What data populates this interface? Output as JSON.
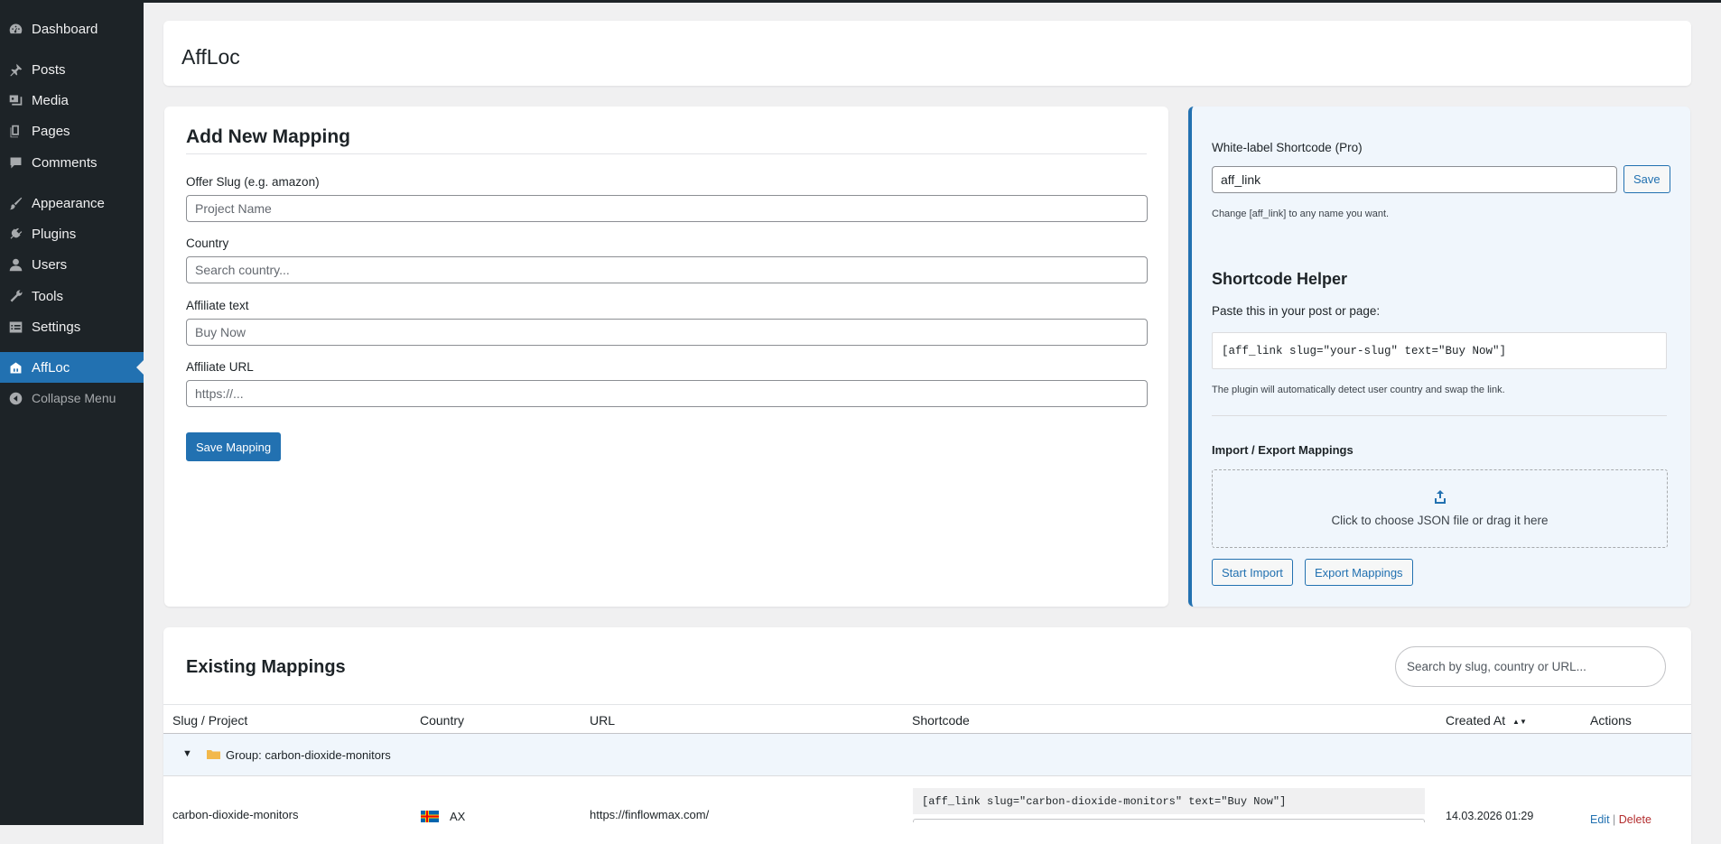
{
  "sidebar": {
    "items": [
      {
        "label": "Dashboard",
        "icon": "dashboard-icon"
      },
      {
        "label": "Posts",
        "icon": "pin-icon"
      },
      {
        "label": "Media",
        "icon": "media-icon"
      },
      {
        "label": "Pages",
        "icon": "pages-icon"
      },
      {
        "label": "Comments",
        "icon": "comment-icon"
      },
      {
        "label": "Appearance",
        "icon": "brush-icon"
      },
      {
        "label": "Plugins",
        "icon": "plugin-icon"
      },
      {
        "label": "Users",
        "icon": "user-icon"
      },
      {
        "label": "Tools",
        "icon": "wrench-icon"
      },
      {
        "label": "Settings",
        "icon": "settings-icon"
      },
      {
        "label": "AffLoc",
        "icon": "affloc-icon",
        "active": true
      }
    ],
    "collapse_label": "Collapse Menu"
  },
  "page": {
    "title": "AffLoc"
  },
  "add_form": {
    "heading": "Add New Mapping",
    "slug_label": "Offer Slug (e.g. amazon)",
    "slug_placeholder": "Project Name",
    "country_label": "Country",
    "country_placeholder": "Search country...",
    "text_label": "Affiliate text",
    "text_placeholder": "Buy Now",
    "url_label": "Affiliate URL",
    "url_placeholder": "https://...",
    "save_button": "Save Mapping"
  },
  "side_panel": {
    "whitelabel_label": "White-label Shortcode (Pro)",
    "whitelabel_value": "aff_link",
    "whitelabel_save": "Save",
    "whitelabel_note": "Change [aff_link] to any name you want.",
    "helper_heading": "Shortcode Helper",
    "helper_intro": "Paste this in your post or page:",
    "helper_code": "[aff_link slug=\"your-slug\" text=\"Buy Now\"]",
    "helper_note": "The plugin will automatically detect user country and swap the link.",
    "import_heading": "Import / Export Mappings",
    "dropzone_text": "Click to choose JSON file or drag it here",
    "start_import": "Start Import",
    "export_button": "Export Mappings"
  },
  "mappings": {
    "heading": "Existing Mappings",
    "search_placeholder": "Search by slug, country or URL...",
    "columns": [
      "Slug / Project",
      "Country",
      "URL",
      "Shortcode",
      "Created At",
      "Actions"
    ],
    "sort_indicator": "▲▼",
    "group": {
      "caret": "▼",
      "label": "Group: carbon-dioxide-monitors"
    },
    "rows": [
      {
        "slug": "carbon-dioxide-monitors",
        "country": "AX",
        "url": "https://finflowmax.com/",
        "shortcode": "[aff_link slug=\"carbon-dioxide-monitors\" text=\"Buy Now\"]",
        "created": "14.03.2026 01:29",
        "edit": "Edit",
        "sep": "|",
        "delete": "Delete"
      }
    ]
  },
  "colors": {
    "sidebar_bg": "#1d2327",
    "accent": "#2271b1",
    "panel_bg": "#f0f6fc",
    "delete": "#b32d2e"
  }
}
